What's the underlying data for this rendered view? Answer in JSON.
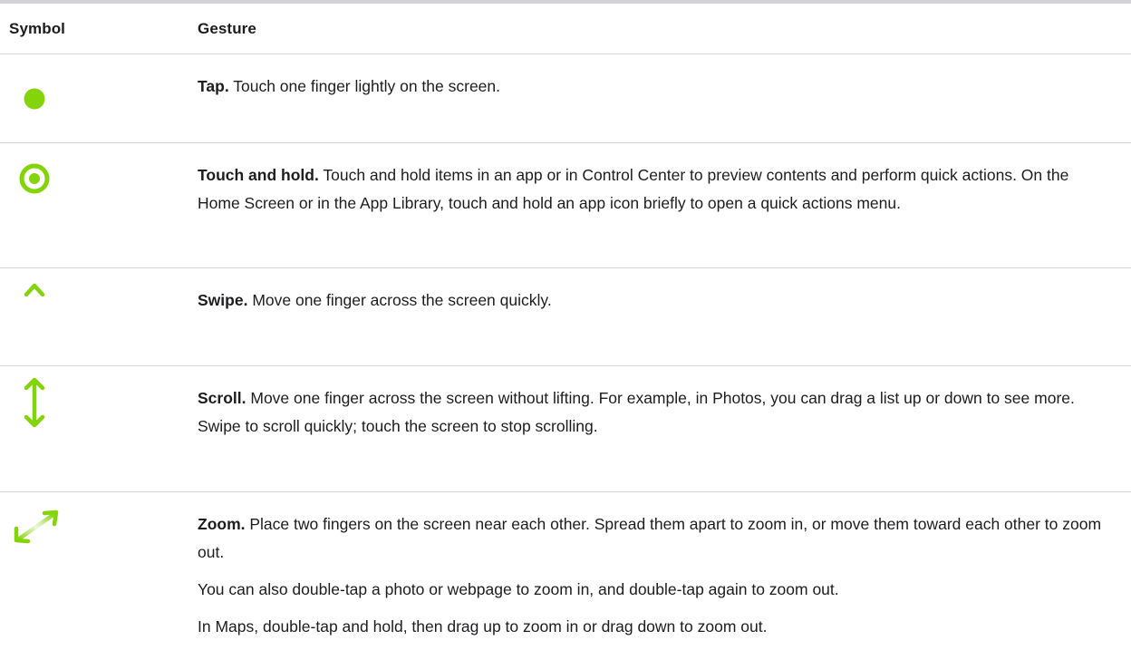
{
  "header": {
    "symbol_label": "Symbol",
    "gesture_label": "Gesture"
  },
  "accent_color": "#84d40a",
  "rows": [
    {
      "icon": "tap-dot-icon",
      "name": "Tap.",
      "paragraphs": [
        "Touch one finger lightly on the screen."
      ]
    },
    {
      "icon": "touch-and-hold-ring-icon",
      "name": "Touch and hold.",
      "paragraphs": [
        "Touch and hold items in an app or in Control Center to preview contents and perform quick actions. On the Home Screen or in the App Library, touch and hold an app icon briefly to open a quick actions menu."
      ]
    },
    {
      "icon": "swipe-arrow-up-icon",
      "name": "Swipe.",
      "paragraphs": [
        "Move one finger across the screen quickly."
      ]
    },
    {
      "icon": "scroll-double-arrow-icon",
      "name": "Scroll.",
      "paragraphs": [
        "Move one finger across the screen without lifting. For example, in Photos, you can drag a list up or down to see more. Swipe to scroll quickly; touch the screen to stop scrolling."
      ]
    },
    {
      "icon": "zoom-diagonal-arrows-icon",
      "name": "Zoom.",
      "paragraphs": [
        "Place two fingers on the screen near each other. Spread them apart to zoom in, or move them toward each other to zoom out.",
        "You can also double-tap a photo or webpage to zoom in, and double-tap again to zoom out.",
        "In Maps, double-tap and hold, then drag up to zoom in or drag down to zoom out."
      ]
    }
  ]
}
